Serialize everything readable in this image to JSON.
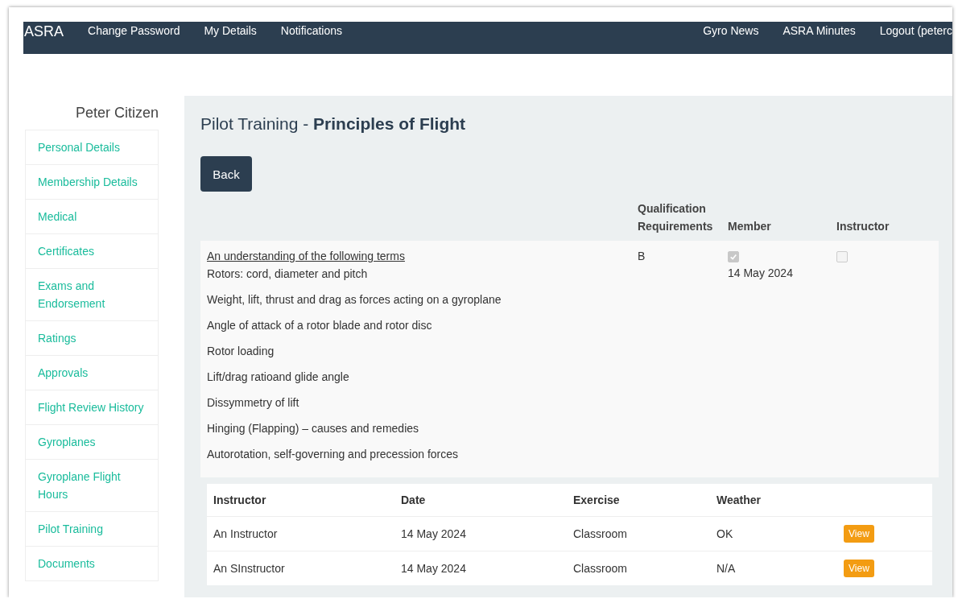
{
  "navbar": {
    "brand": "ASRA",
    "left_links": [
      "Change Password",
      "My Details",
      "Notifications"
    ],
    "right_links": [
      "Gyro News",
      "ASRA Minutes",
      "Logout (peterc"
    ]
  },
  "sidebar": {
    "user_name": "Peter Citizen",
    "items": [
      {
        "label": "Personal Details"
      },
      {
        "label": "Membership Details"
      },
      {
        "label": "Medical"
      },
      {
        "label": "Certificates"
      },
      {
        "label": "Exams and Endorsement"
      },
      {
        "label": "Ratings"
      },
      {
        "label": "Approvals"
      },
      {
        "label": "Flight Review History"
      },
      {
        "label": "Gyroplanes"
      },
      {
        "label": "Gyroplane Flight Hours"
      },
      {
        "label": "Pilot Training"
      },
      {
        "label": "Documents"
      }
    ]
  },
  "page": {
    "title": "Pilot Training - **Principles of Flight**",
    "back_button": "Back"
  },
  "requirements": {
    "columns": [
      "Qualification Requirements",
      "Member",
      "Instructor"
    ],
    "topic": {
      "heading": "An understanding of the following terms",
      "items": [
        "Rotors: cord, diameter and pitch",
        "Weight, lift, thrust and drag as forces acting on a gyroplane",
        "Angle of attack of a rotor blade and rotor disc",
        "Rotor loading",
        "Lift/drag ratioand glide angle",
        "Dissymmetry of lift",
        "Hinging (Flapping) – causes and remedies",
        "Autorotation, self-governing and precession forces"
      ],
      "qualification": "B",
      "member": {
        "checked": true,
        "disabled": true,
        "date": "14 May 2024"
      },
      "instructor": {
        "checked": false,
        "disabled": true
      }
    }
  },
  "log": {
    "columns": [
      "Instructor",
      "Date",
      "Exercise",
      "Weather"
    ],
    "rows": [
      {
        "instructor": "An Instructor",
        "date": "14 May 2024",
        "exercise": "Classroom",
        "weather": "OK",
        "action": "View"
      },
      {
        "instructor": "An SInstructor",
        "date": "14 May 2024",
        "exercise": "Classroom",
        "weather": "N/A",
        "action": "View"
      }
    ]
  }
}
